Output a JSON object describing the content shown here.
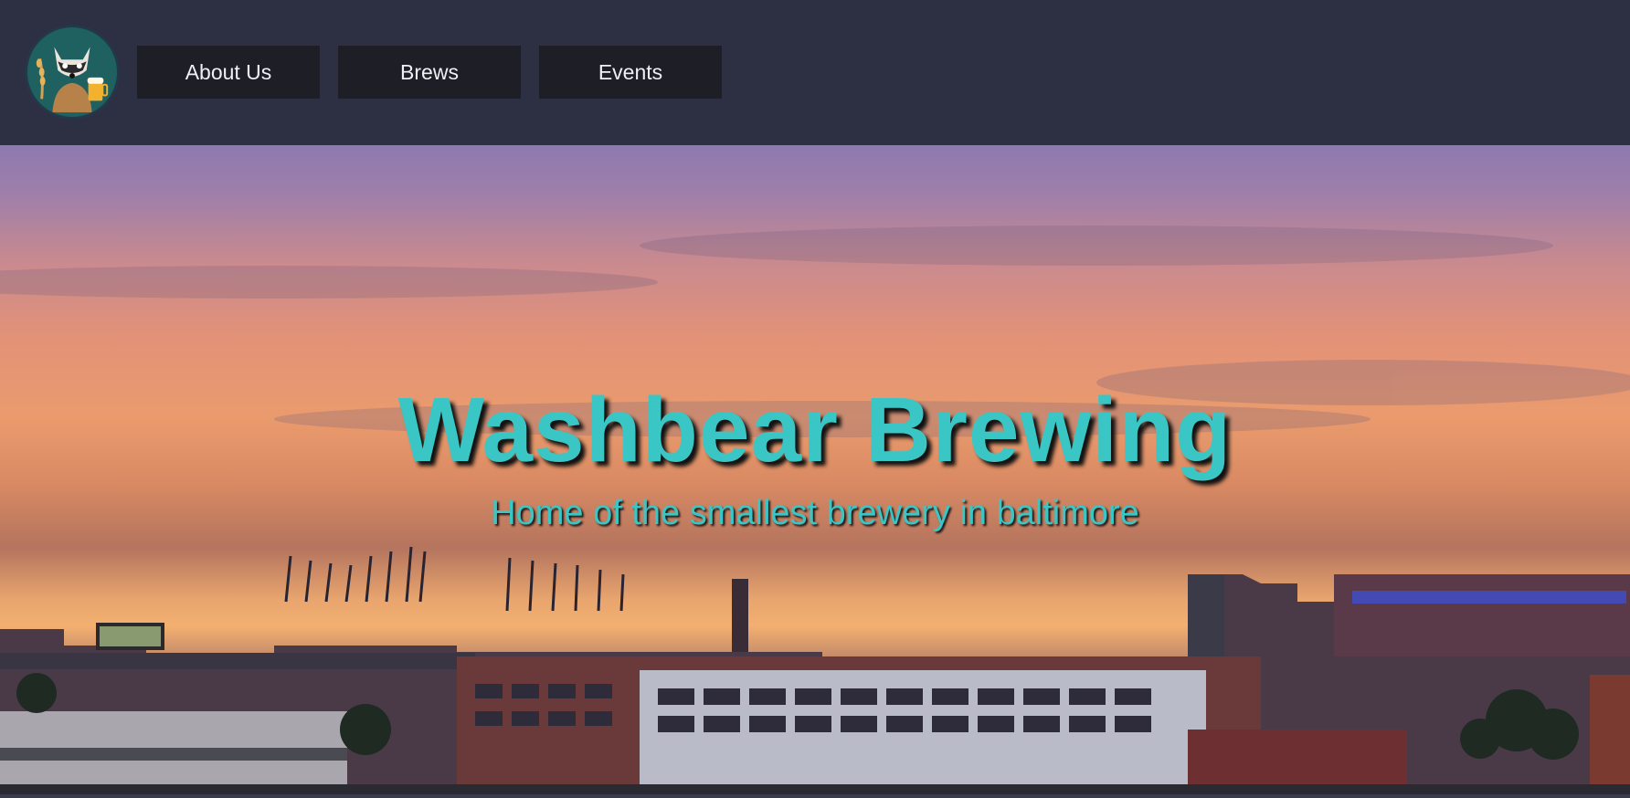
{
  "nav": {
    "logo_icon": "raccoon-beer-logo-icon",
    "items": [
      {
        "label": "About Us"
      },
      {
        "label": "Brews"
      },
      {
        "label": "Events"
      }
    ]
  },
  "hero": {
    "title": "Washbear Brewing",
    "subtitle": "Home of the smallest brewery in baltimore",
    "background": "baltimore-sunset-skyline-image"
  },
  "colors": {
    "nav_bg": "#2d2f42",
    "button_bg": "#1d1e26",
    "accent_teal": "#3bc6c6"
  }
}
